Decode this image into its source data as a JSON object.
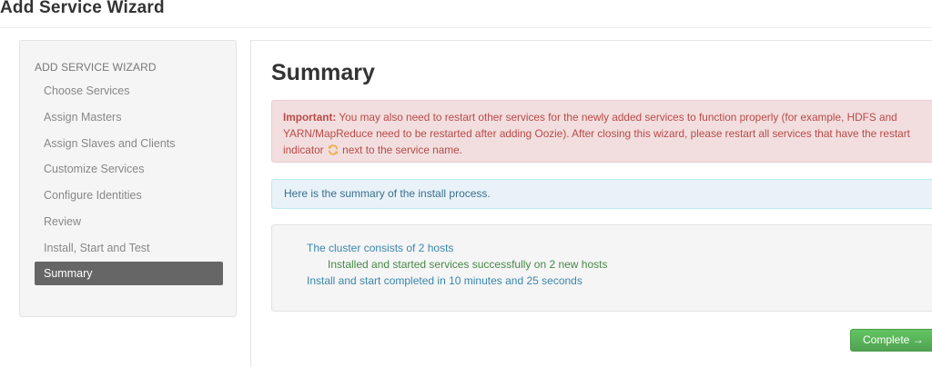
{
  "page": {
    "title": "Add Service Wizard"
  },
  "sidebar": {
    "header": "ADD SERVICE WIZARD",
    "items": [
      {
        "label": "Choose Services"
      },
      {
        "label": "Assign Masters"
      },
      {
        "label": "Assign Slaves and Clients"
      },
      {
        "label": "Customize Services"
      },
      {
        "label": "Configure Identities"
      },
      {
        "label": "Review"
      },
      {
        "label": "Install, Start and Test"
      },
      {
        "label": "Summary"
      }
    ],
    "active_item": "Summary"
  },
  "main": {
    "title": "Summary",
    "important_alert": {
      "label": "Important:",
      "text_before_icon": " You may also need to restart other services for the newly added services to function properly (for example, HDFS and YARN/MapReduce need to be restarted after adding Oozie). After closing this wizard, please restart all services that have the restart indicator ",
      "icon": "refresh-icon",
      "text_after_icon": " next to the service name."
    },
    "info_alert": "Here is the summary of the install process.",
    "summary": {
      "hosts_line": "The cluster consists of 2 hosts",
      "services_line": "Installed and started services successfully on 2 new hosts",
      "duration_line": "Install and start completed in 10 minutes and 25 seconds"
    },
    "complete_button": "Complete →"
  },
  "colors": {
    "alert_error_bg": "#f2dede",
    "alert_error_text": "#b94a48",
    "alert_info_bg": "#e8f2f8",
    "success_text": "#468847",
    "info_text": "#3a87ad",
    "button_green": "#51a351",
    "sidebar_active": "#666666",
    "restart_icon": "#f0ad4e"
  }
}
